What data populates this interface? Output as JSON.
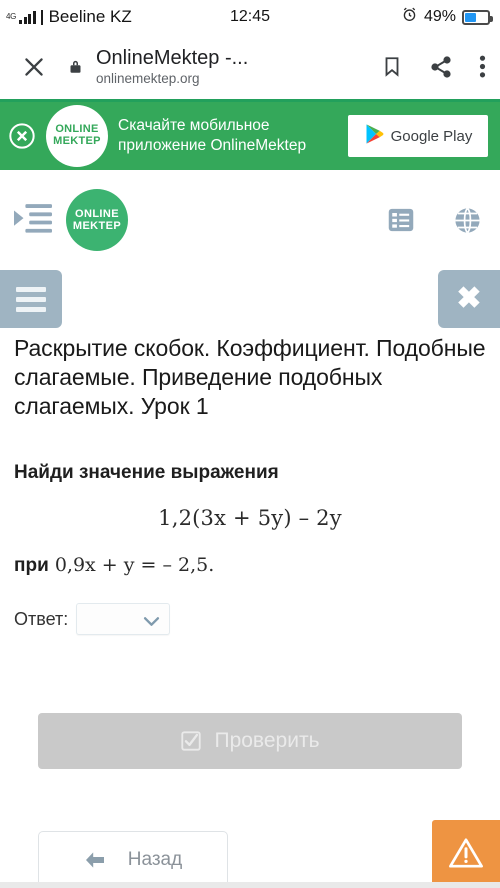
{
  "statusbar": {
    "network_type": "4G",
    "carrier": "Beeline KZ",
    "time": "12:45",
    "battery_percent": "49%",
    "alarm_icon": "alarm-clock-icon",
    "battery_level": 49
  },
  "browser": {
    "close_icon": "close-icon",
    "lock_icon": "lock-icon",
    "title": "OnlineMektep -...",
    "url": "onlinemektep.org",
    "bookmark_icon": "bookmark-icon",
    "share_icon": "share-icon",
    "menu_icon": "overflow-menu-icon",
    "accent_color": "#22a05c"
  },
  "promo": {
    "close_icon": "close-circle-icon",
    "logo_line1": "ONLINE",
    "logo_line2": "MEKTEP",
    "text_line1": "Скачайте мобильное",
    "text_line2": "приложение OnlineMektep",
    "store_button_label": "Google Play",
    "background_color": "#34a85a"
  },
  "site_header": {
    "indent_icon": "indent-list-icon",
    "logo_line1": "ONLINE",
    "logo_line2": "MEKTEP",
    "list_icon": "list-view-icon",
    "globe_icon": "globe-icon",
    "logo_color": "#3cb371",
    "icon_color": "#93a9bb"
  },
  "lesson": {
    "menu_icon": "hamburger-icon",
    "close_icon": "close-icon",
    "title": "Раскрытие скобок. Коэффициент. Подобные слагаемые. Приведение подобных слагаемых. Урок 1",
    "prompt": "Найди значение выражения",
    "formula": "1,2(3x + 5y) – 2y",
    "condition_prefix": "при",
    "condition": "0,9x + y = – 2,5.",
    "answer_label": "Ответ:",
    "answer_value": "",
    "answer_dropdown_icon": "chevron-down-icon",
    "check_button_label": "Проверить",
    "check_button_icon": "checkbox-checked-icon",
    "check_button_color": "#c9c9c9",
    "back_button_label": "Назад",
    "back_button_icon": "arrow-left-icon",
    "warning_icon": "warning-triangle-icon",
    "warning_color": "#ee9442"
  }
}
